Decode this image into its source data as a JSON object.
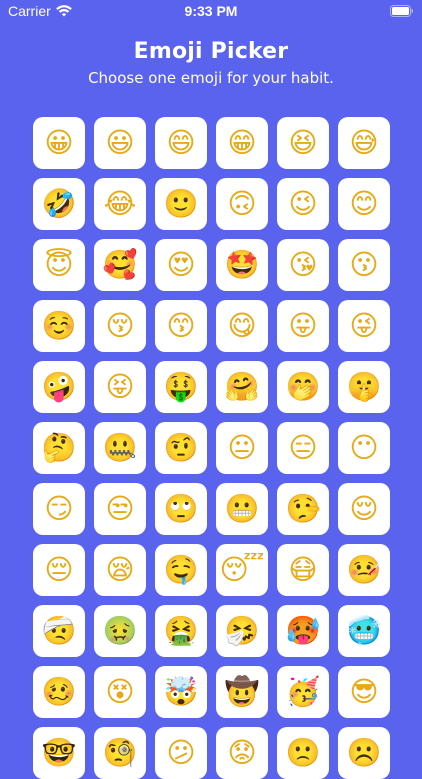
{
  "status_bar": {
    "carrier": "Carrier",
    "time": "9:33 PM",
    "wifi_icon": "wifi-icon",
    "battery_icon": "battery-icon"
  },
  "header": {
    "title": "Emoji Picker",
    "subtitle": "Choose one emoji for your habit."
  },
  "colors": {
    "background": "#5a63ee",
    "cell_background": "#ffffff",
    "text": "#ffffff"
  },
  "emojis": [
    "😀",
    "😃",
    "😄",
    "😁",
    "😆",
    "😅",
    "🤣",
    "😂",
    "🙂",
    "🙃",
    "😉",
    "😊",
    "😇",
    "🥰",
    "😍",
    "🤩",
    "😘",
    "😗",
    "☺️",
    "😚",
    "😙",
    "😋",
    "😛",
    "😜",
    "🤪",
    "😝",
    "🤑",
    "🤗",
    "🤭",
    "🤫",
    "🤔",
    "🤐",
    "🤨",
    "😐",
    "😑",
    "😶",
    "😏",
    "😒",
    "🙄",
    "😬",
    "🤥",
    "😌",
    "😔",
    "😪",
    "🤤",
    "😴",
    "😷",
    "🤒",
    "🤕",
    "🤢",
    "🤮",
    "🤧",
    "🥵",
    "🥶",
    "🥴",
    "😵",
    "🤯",
    "🤠",
    "🥳",
    "😎",
    "🤓",
    "🧐",
    "😕",
    "😟",
    "🙁",
    "☹️"
  ]
}
